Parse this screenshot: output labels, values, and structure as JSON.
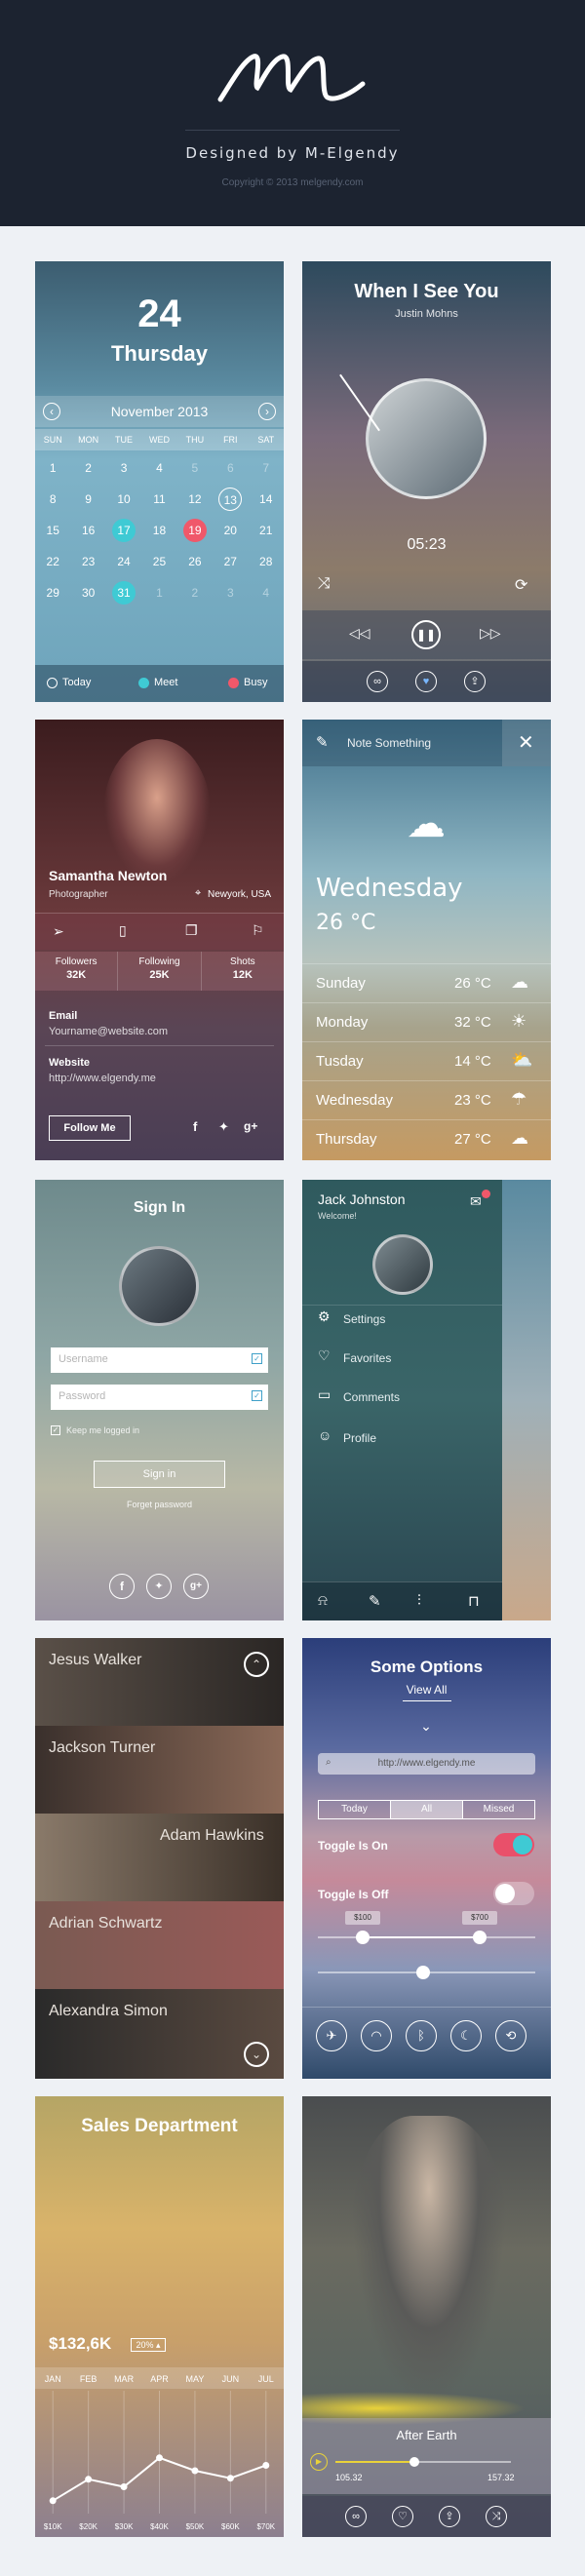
{
  "header": {
    "title": "Designed by M-Elgendy",
    "copyright": "Copyright © 2013 melgendy.com"
  },
  "calendar": {
    "day": "24",
    "weekday": "Thursday",
    "month": "November 2013",
    "dow": [
      "SUN",
      "MON",
      "TUE",
      "WED",
      "THU",
      "FRI",
      "SAT"
    ],
    "weeks": [
      [
        "1",
        "2",
        "3",
        "4",
        "5",
        "6",
        "7"
      ],
      [
        "8",
        "9",
        "10",
        "11",
        "12",
        "13",
        "14"
      ],
      [
        "15",
        "16",
        "17",
        "18",
        "19",
        "20",
        "21"
      ],
      [
        "22",
        "23",
        "24",
        "25",
        "26",
        "27",
        "28"
      ],
      [
        "29",
        "30",
        "31",
        "1",
        "2",
        "3",
        "4"
      ]
    ],
    "legend": [
      "Today",
      "Meet",
      "Busy"
    ],
    "colors": {
      "today": "#ffffff",
      "meet": "#3fcad4",
      "busy": "#f0586a"
    }
  },
  "player": {
    "title": "When I See You",
    "artist": "Justin Mohns",
    "time": "05:23"
  },
  "profile": {
    "name": "Samantha Newton",
    "role": "Photographer",
    "location": "Newyork, USA",
    "stats": [
      {
        "label": "Followers",
        "value": "32K"
      },
      {
        "label": "Following",
        "value": "25K"
      },
      {
        "label": "Shots",
        "value": "12K"
      }
    ],
    "email_label": "Email",
    "email": "Yourname@website.com",
    "website_label": "Website",
    "website": "http://www.elgendy.me",
    "follow": "Follow Me"
  },
  "weather": {
    "note": "Note Something",
    "day": "Wednesday",
    "temp": "26 °C",
    "forecast": [
      {
        "day": "Sunday",
        "temp": "26 °C"
      },
      {
        "day": "Monday",
        "temp": "32 °C"
      },
      {
        "day": "Tusday",
        "temp": "14 °C"
      },
      {
        "day": "Wednesday",
        "temp": "23 °C"
      },
      {
        "day": "Thursday",
        "temp": "27 °C"
      }
    ]
  },
  "signin": {
    "title": "Sign In",
    "username": "Username",
    "password": "Password",
    "keep": "Keep me logged in",
    "button": "Sign in",
    "forgot": "Forget password"
  },
  "menu": {
    "name": "Jack Johnston",
    "greeting": "Welcome!",
    "items": [
      "Settings",
      "Favorites",
      "Comments",
      "Profile"
    ]
  },
  "people": {
    "names": [
      "Jesus Walker",
      "Jackson Turner",
      "Adam Hawkins",
      "Adrian Schwartz",
      "Alexandra Simon"
    ]
  },
  "options": {
    "title": "Some Options",
    "view_all": "View All",
    "url": "http://www.elgendy.me",
    "segments": [
      "Today",
      "All",
      "Missed"
    ],
    "toggle_on": "Toggle Is On",
    "toggle_off": "Toggle Is Off",
    "range_min": "$100",
    "range_max": "$700"
  },
  "sales": {
    "title": "Sales Department",
    "total": "$132,6K",
    "change": "20%",
    "chart_data": {
      "type": "line",
      "categories": [
        "JAN",
        "FEB",
        "MAR",
        "APR",
        "MAY",
        "JUN",
        "JUL"
      ],
      "x_ticks": [
        "$10K",
        "$20K",
        "$30K",
        "$40K",
        "$50K",
        "$60K",
        "$70K"
      ],
      "values": [
        12,
        32,
        25,
        52,
        40,
        33,
        45
      ],
      "ylim": [
        0,
        100
      ]
    }
  },
  "music": {
    "title": "After Earth",
    "elapsed": "105.32",
    "total": "157.32",
    "progress": 0.45
  }
}
